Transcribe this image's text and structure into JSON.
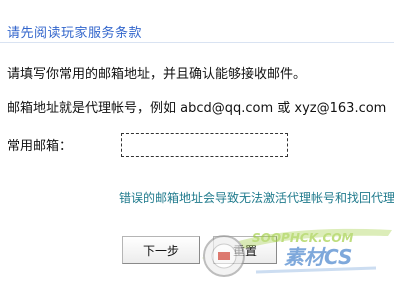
{
  "title": "请先阅读玩家服务条款",
  "instructions": {
    "line1": "请填写你常用的邮箱地址，并且确认能够接收邮件。",
    "line2": "邮箱地址就是代理帐号，例如 abcd@qq.com 或 xyz@163.com"
  },
  "email": {
    "label": "常用邮箱：",
    "value": "",
    "placeholder": ""
  },
  "warning": "错误的邮箱地址会导致无法激活代理帐号和找回代理",
  "buttons": {
    "next": "下一步",
    "reset": "重置"
  },
  "watermark": {
    "text_top": "SOOPHCK.COM",
    "text_bottom": "素材CS"
  },
  "colors": {
    "title": "#3366cc",
    "warning": "#1f7a8c",
    "watermark_green": "#9ccc3a",
    "watermark_blue": "#3a7ac8",
    "watermark_red": "#d23a2a"
  }
}
